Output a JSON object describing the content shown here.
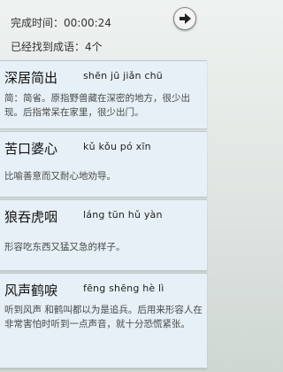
{
  "header": {
    "time_label": "完成时间：00:00:24",
    "found_label": "已经找到成语：4个"
  },
  "idioms": [
    {
      "title": "深居简出",
      "pinyin": "shēn  jū  jiǎn  chū",
      "desc": "简：简省。原指野兽藏在深密的地方，很少出现。后指常呆在家里，很少出门。"
    },
    {
      "title": "苦口婆心",
      "pinyin": "kǔ  kǒu  pó  xīn",
      "desc": "比喻善意而又耐心地劝导。"
    },
    {
      "title": "狼吞虎咽",
      "pinyin": "láng  tūn  hǔ  yàn",
      "desc": "形容吃东西又猛又急的样子。"
    },
    {
      "title": "风声鹤唳",
      "pinyin": "fēng shēng hè  lì",
      "desc": "听到风声 和鹤叫都以为是追兵。后用来形容人在非常害怕时听到一点声音，就十分恐慌紧张。"
    }
  ],
  "icons": {
    "next": "arrow-right-icon"
  }
}
